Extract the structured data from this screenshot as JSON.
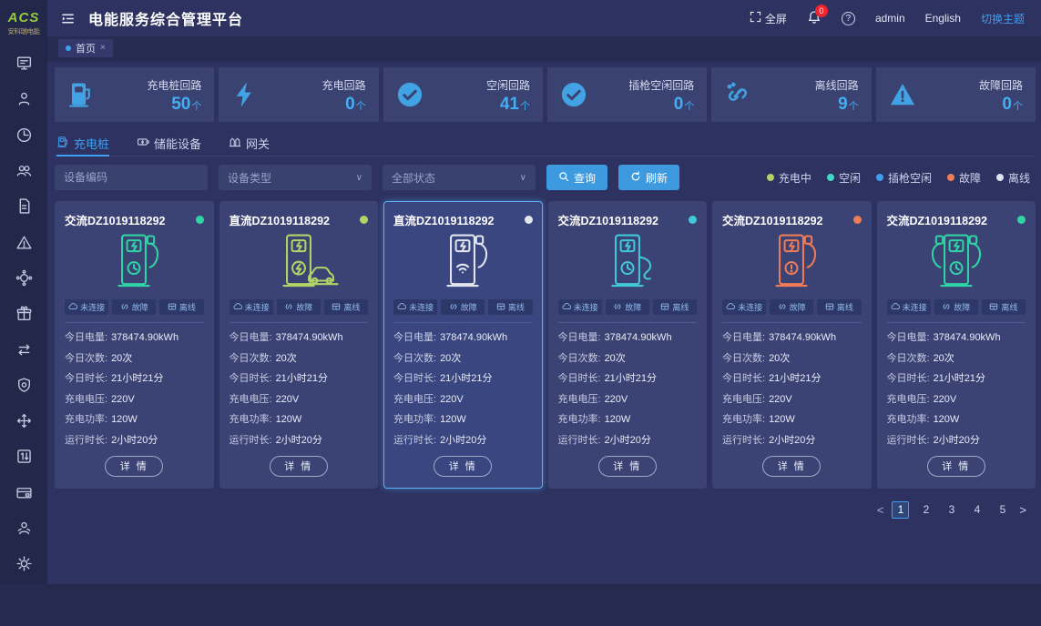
{
  "colors": {
    "accent_blue": "#3f9ef0",
    "badge_red": "#f5222d",
    "status_charging": "#b3d465",
    "status_idle": "#41d9c6",
    "status_plugged_idle": "#3f9ef0",
    "status_fault": "#ef7b57",
    "status_offline": "#dfe3ee"
  },
  "header": {
    "logo_text": "ACS",
    "logo_subtext": "安科瑞电能",
    "title": "电能服务综合管理平台",
    "fullscreen_label": "全屏",
    "notification_badge": "0",
    "username": "admin",
    "language_label": "English",
    "theme_switch_label": "切换主题"
  },
  "breadcrumb": {
    "tag_label": "首页",
    "close_label": "×"
  },
  "sidebar": {
    "items": [
      {
        "icon": "monitor-icon"
      },
      {
        "icon": "user-icon"
      },
      {
        "icon": "clock-icon"
      },
      {
        "icon": "users-icon"
      },
      {
        "icon": "document-icon"
      },
      {
        "icon": "alert-triangle-icon"
      },
      {
        "icon": "network-icon"
      },
      {
        "icon": "gift-icon"
      },
      {
        "icon": "transfer-arrows-icon"
      },
      {
        "icon": "shield-icon"
      },
      {
        "icon": "move-cross-icon"
      },
      {
        "icon": "sort-number-icon"
      },
      {
        "icon": "billing-card-icon"
      },
      {
        "icon": "person-icon"
      },
      {
        "icon": "gear-icon"
      }
    ]
  },
  "stats": [
    {
      "label": "充电桩回路",
      "value": "50",
      "unit": "个",
      "icon": "charging-pile-icon",
      "variant": "pile"
    },
    {
      "label": "充电回路",
      "value": "0",
      "unit": "个",
      "icon": "lightning-icon",
      "variant": "bolt"
    },
    {
      "label": "空闲回路",
      "value": "41",
      "unit": "个",
      "icon": "check-circle-icon",
      "variant": "check"
    },
    {
      "label": "插枪空闲回路",
      "value": "0",
      "unit": "个",
      "icon": "check-circle-icon",
      "variant": "check"
    },
    {
      "label": "离线回路",
      "value": "9",
      "unit": "个",
      "icon": "offline-link-icon",
      "variant": "unlink"
    },
    {
      "label": "故障回路",
      "value": "0",
      "unit": "个",
      "icon": "alert-triangle-icon",
      "variant": "warning"
    }
  ],
  "tabs": [
    {
      "label": "充电桩",
      "active": true,
      "variant": "pile",
      "icon": "charging-pile-icon"
    },
    {
      "label": "储能设备",
      "active": false,
      "variant": "battery",
      "icon": "battery-icon"
    },
    {
      "label": "网关",
      "active": false,
      "variant": "gateway",
      "icon": "gateway-icon"
    }
  ],
  "filters": {
    "device_code_placeholder": "设备编码",
    "device_type_placeholder": "设备类型",
    "status_value": "全部状态",
    "search_label": "查询",
    "refresh_label": "刷新"
  },
  "legend": [
    {
      "label": "充电中",
      "color": "#b3d465"
    },
    {
      "label": "空闲",
      "color": "#41d9c6"
    },
    {
      "label": "插枪空闲",
      "color": "#3f9ef0"
    },
    {
      "label": "故障",
      "color": "#ef7b57"
    },
    {
      "label": "离线",
      "color": "#dfe3ee"
    }
  ],
  "card_common": {
    "chips": [
      {
        "label": "未连接",
        "icon": "cloud-icon"
      },
      {
        "label": "故障",
        "icon": "broken-link-icon"
      },
      {
        "label": "离线",
        "icon": "grid-icon"
      }
    ],
    "fields": [
      {
        "label": "今日电量:",
        "value": "378474.90kWh"
      },
      {
        "label": "今日次数:",
        "value": "20次"
      },
      {
        "label": "今日时长:",
        "value": "21小时21分"
      },
      {
        "label": "充电电压:",
        "value": "220V"
      },
      {
        "label": "充电功率:",
        "value": "120W"
      },
      {
        "label": "运行时长:",
        "value": "2小时20分"
      }
    ],
    "detail_label": "详 情"
  },
  "cards": [
    {
      "title": "交流DZ1019118292",
      "status_color": "#2fd5a5",
      "variant": "ac",
      "selected": false
    },
    {
      "title": "直流DZ1019118292",
      "status_color": "#b3d465",
      "variant": "dc-car",
      "selected": false
    },
    {
      "title": "直流DZ1019118292",
      "status_color": "#e3e6ef",
      "variant": "dc-wifi",
      "selected": true
    },
    {
      "title": "交流DZ1019118292",
      "status_color": "#41c8d9",
      "variant": "ac-cable",
      "selected": false
    },
    {
      "title": "交流DZ1019118292",
      "status_color": "#ef7b57",
      "variant": "ac-fault",
      "selected": false
    },
    {
      "title": "交流DZ1019118292",
      "status_color": "#2fd5a5",
      "variant": "ac-dual",
      "selected": false
    }
  ],
  "pagination": {
    "prev_label": "<",
    "next_label": ">",
    "pages": [
      {
        "label": "1",
        "current": true
      },
      {
        "label": "2",
        "current": false
      },
      {
        "label": "3",
        "current": false
      },
      {
        "label": "4",
        "current": false
      },
      {
        "label": "5",
        "current": false
      }
    ]
  }
}
